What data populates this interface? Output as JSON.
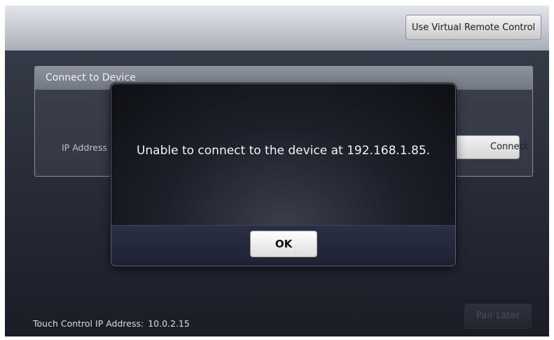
{
  "topbar": {
    "virtual_remote_label": "Use Virtual Remote Control"
  },
  "panel": {
    "title": "Connect to Device",
    "ip_label": "IP Address",
    "connect_label": "Connect"
  },
  "dialog": {
    "message": "Unable to connect to the device at 192.168.1.85.",
    "ok_label": "OK"
  },
  "footer": {
    "ip_label": "Touch Control IP Address:",
    "ip_value": "10.0.2.15",
    "pair_later_label": "Pair Later"
  }
}
